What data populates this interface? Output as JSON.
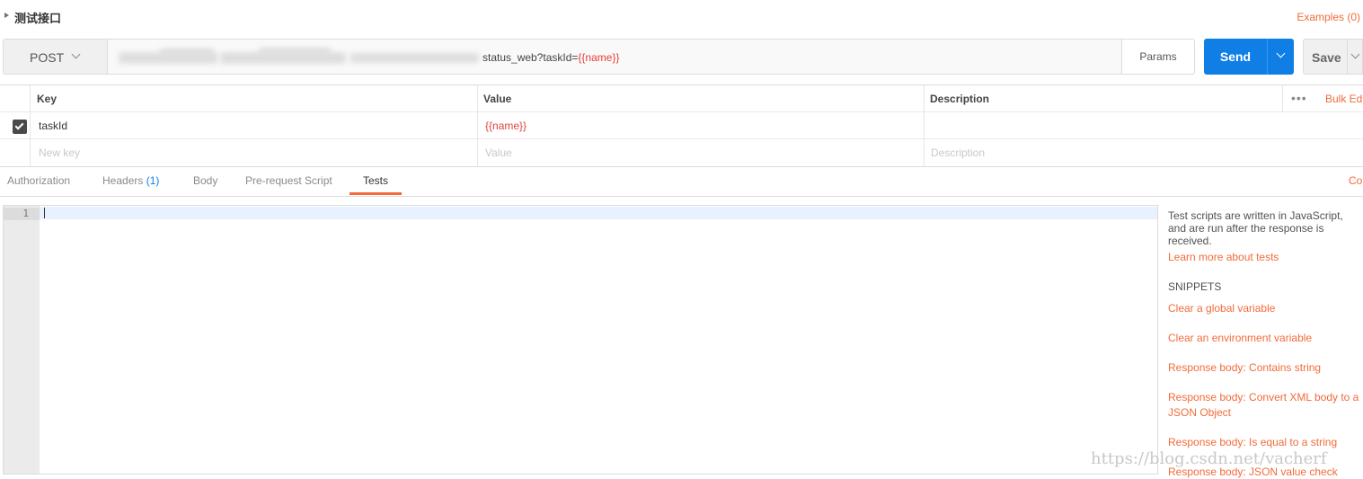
{
  "request": {
    "name": "测试接口"
  },
  "examples_label": "Examples (0)",
  "url_bar": {
    "method": "POST",
    "url_visible": "status_web?taskId=",
    "url_variable": "{{name}}",
    "params_label": "Params",
    "send_label": "Send",
    "save_label": "Save"
  },
  "params_table": {
    "headers": {
      "key": "Key",
      "value": "Value",
      "description": "Description"
    },
    "rows": [
      {
        "key": "taskId",
        "value": "{{name}}",
        "description": ""
      }
    ],
    "placeholders": {
      "key": "New key",
      "value": "Value",
      "description": "Description"
    },
    "more_icon": "•••",
    "bulk_edit_label": "Bulk Ed"
  },
  "tabs": {
    "items": [
      {
        "label": "Authorization"
      },
      {
        "label": "Headers",
        "count": "(1)"
      },
      {
        "label": "Body"
      },
      {
        "label": "Pre-request Script"
      },
      {
        "label": "Tests"
      }
    ],
    "active": "Tests",
    "right_link": "Co"
  },
  "editor": {
    "line_numbers": [
      "1"
    ]
  },
  "sidebar": {
    "description": "Test scripts are written in JavaScript, and are run after the response is received.",
    "learn_more": "Learn more about tests",
    "snippets_title": "SNIPPETS",
    "snippets": [
      "Clear a global variable",
      "Clear an environment variable",
      "Response body: Contains string",
      "Response body: Convert XML body to a",
      "JSON Object",
      "Response body: Is equal to a string",
      "Response body: JSON value check"
    ]
  },
  "watermark": "https://blog.csdn.net/vacherf",
  "colors": {
    "accent": "#f26b3a",
    "primary": "#0f7fe6",
    "variable": "#e2423b"
  }
}
